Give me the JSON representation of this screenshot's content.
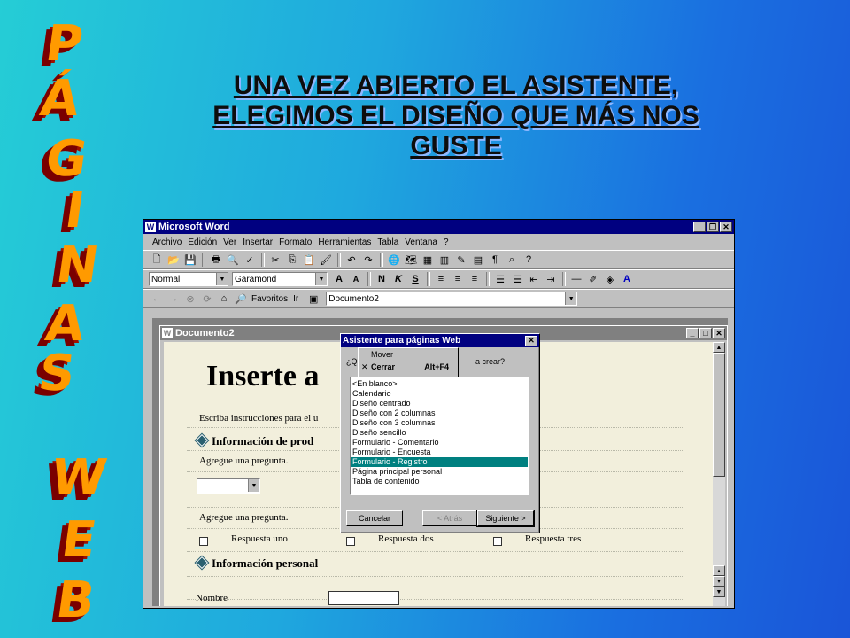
{
  "side_title_letters": [
    "P",
    "Á",
    "G",
    "I",
    "N",
    "A",
    "S",
    "W",
    "E",
    "B"
  ],
  "headline": "UNA VEZ ABIERTO EL ASISTENTE,\nELEGIMOS EL DISEÑO QUE MÁS NOS\nGUSTE",
  "word": {
    "title": "Microsoft Word",
    "menu": [
      "Archivo",
      "Edición",
      "Ver",
      "Insertar",
      "Formato",
      "Herramientas",
      "Tabla",
      "Ventana",
      "?"
    ],
    "style_combo": "Normal",
    "font_combo": "Garamond",
    "web_toolbar": {
      "favorites": "Favoritos",
      "go": "Ir",
      "address": "Documento2"
    }
  },
  "document": {
    "title": "Documento2",
    "heading": "Inserte a",
    "instructions": "Escriba instrucciones para el u",
    "section1": "Información de prod",
    "question1": "Agregue una pregunta.",
    "question2": "Agregue una pregunta.",
    "answers": [
      "Respuesta uno",
      "Respuesta dos",
      "Respuesta tres"
    ],
    "section2": "Información personal",
    "name_label": "Nombre"
  },
  "dialog": {
    "title": "Asistente para páginas Web",
    "prompt_start": "¿Q",
    "prompt_end": "a crear?",
    "items": [
      "<En blanco>",
      "Calendario",
      "Diseño centrado",
      "Diseño con 2 columnas",
      "Diseño con 3 columnas",
      "Diseño sencillo",
      "Formulario - Comentario",
      "Formulario - Encuesta",
      "Formulario - Registro",
      "Página principal personal",
      "Tabla de contenido"
    ],
    "selected_index": 8,
    "cancel": "Cancelar",
    "back": "< Atrás",
    "next": "Siguiente >"
  },
  "system_menu": {
    "move": "Mover",
    "close": "Cerrar",
    "close_shortcut": "Alt+F4"
  }
}
